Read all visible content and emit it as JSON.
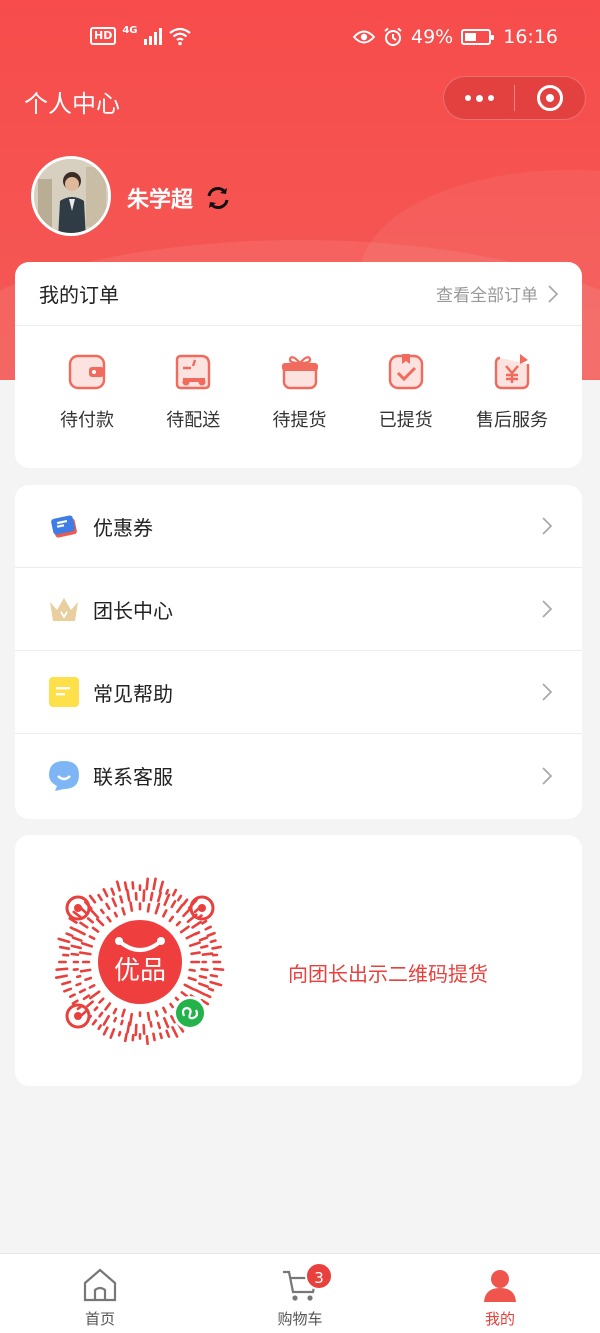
{
  "status_bar": {
    "network_badge": "HD",
    "network_type": "4G",
    "battery": "49%",
    "battery_level": 0.49,
    "time": "16:16"
  },
  "nav": {
    "title": "个人中心"
  },
  "profile": {
    "username": "朱学超"
  },
  "orders": {
    "title": "我的订单",
    "view_all": "查看全部订单",
    "items": [
      {
        "label": "待付款",
        "icon": "wallet-icon"
      },
      {
        "label": "待配送",
        "icon": "delivery-truck-icon"
      },
      {
        "label": "待提货",
        "icon": "gift-box-icon"
      },
      {
        "label": "已提货",
        "icon": "picked-up-check-icon"
      },
      {
        "label": "售后服务",
        "icon": "after-sales-yuan-icon"
      }
    ]
  },
  "menu": {
    "items": [
      {
        "label": "优惠券",
        "icon": "coupon-icon"
      },
      {
        "label": "团长中心",
        "icon": "crown-icon"
      },
      {
        "label": "常见帮助",
        "icon": "help-note-icon"
      },
      {
        "label": "联系客服",
        "icon": "chat-bubble-icon"
      }
    ]
  },
  "qr": {
    "logo_text": "优品",
    "message": "向团长出示二维码提货"
  },
  "tabbar": {
    "items": [
      {
        "label": "首页",
        "icon": "home-icon"
      },
      {
        "label": "购物车",
        "icon": "cart-icon",
        "badge": "3"
      },
      {
        "label": "我的",
        "icon": "profile-icon",
        "active": true
      }
    ]
  },
  "colors": {
    "brand_red": "#f74c4b",
    "accent_text": "#e8403c",
    "background": "#f4f4f4"
  }
}
